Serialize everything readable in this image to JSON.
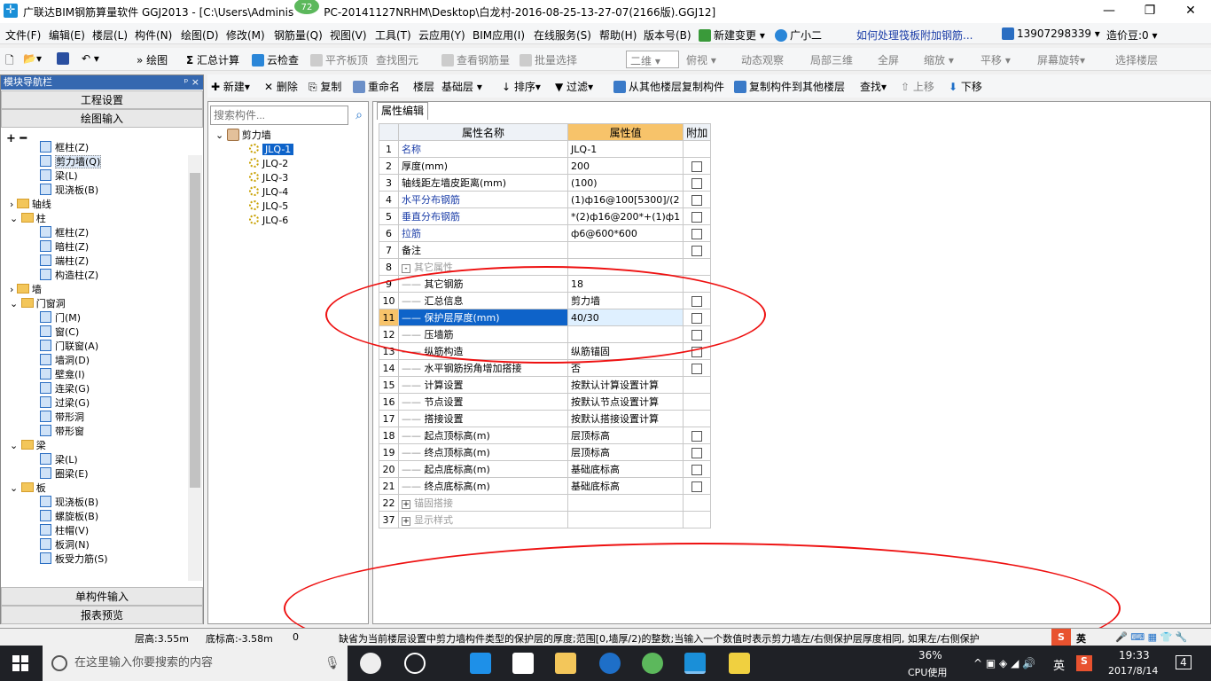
{
  "window": {
    "title": "广联达BIM钢筋算量软件 GGJ2013 - [C:\\Users\\Adminis",
    "title_rest": "PC-20141127NRHM\\Desktop\\白龙村-2016-08-25-13-27-07(2166版).GGJ12]",
    "badge": "72",
    "min": "—",
    "max": "❐",
    "close": "✕"
  },
  "menu": [
    "文件(F)",
    "编辑(E)",
    "楼层(L)",
    "构件(N)",
    "绘图(D)",
    "修改(M)",
    "钢筋量(Q)",
    "视图(V)",
    "工具(T)",
    "云应用(Y)",
    "BIM应用(I)",
    "在线服务(S)",
    "帮助(H)",
    "版本号(B)"
  ],
  "menu_extra": {
    "new_change": "新建变更",
    "assistant": "广小二",
    "question": "如何处理筏板附加钢筋...",
    "phone": "13907298339",
    "beans": "造价豆:0"
  },
  "toolbar1": {
    "draw": "绘图",
    "sum": "汇总计算",
    "cloud": "云检查",
    "flat": "平齐板顶",
    "find": "查找图元",
    "view_steel": "查看钢筋量",
    "batch": "批量选择",
    "mode": "二维",
    "top": "俯视",
    "dyn": "动态观察",
    "local3d": "局部三维",
    "full": "全屏",
    "zoom": "缩放",
    "pan": "平移",
    "rotate": "屏幕旋转",
    "floor": "选择楼层"
  },
  "nav": {
    "header": "模块导航栏",
    "pin": "ᵖ ×",
    "project": "工程设置",
    "drawing": "绘图输入",
    "single": "单构件输入",
    "report": "报表预览",
    "tree": [
      {
        "t": "框柱(Z)",
        "lv": 2,
        "i": "c"
      },
      {
        "t": "剪力墙(Q)",
        "lv": 2,
        "i": "c",
        "sel": true
      },
      {
        "t": "梁(L)",
        "lv": 2,
        "i": "c"
      },
      {
        "t": "现浇板(B)",
        "lv": 2,
        "i": "c"
      },
      {
        "t": "轴线",
        "lv": 1,
        "i": "f",
        "ex": "›"
      },
      {
        "t": "柱",
        "lv": 1,
        "i": "f",
        "ex": "⌄"
      },
      {
        "t": "框柱(Z)",
        "lv": 2,
        "i": "c"
      },
      {
        "t": "暗柱(Z)",
        "lv": 2,
        "i": "c"
      },
      {
        "t": "端柱(Z)",
        "lv": 2,
        "i": "c"
      },
      {
        "t": "构造柱(Z)",
        "lv": 2,
        "i": "c"
      },
      {
        "t": "墙",
        "lv": 1,
        "i": "f",
        "ex": "›"
      },
      {
        "t": "门窗洞",
        "lv": 1,
        "i": "f",
        "ex": "⌄"
      },
      {
        "t": "门(M)",
        "lv": 2,
        "i": "c"
      },
      {
        "t": "窗(C)",
        "lv": 2,
        "i": "c"
      },
      {
        "t": "门联窗(A)",
        "lv": 2,
        "i": "c"
      },
      {
        "t": "墙洞(D)",
        "lv": 2,
        "i": "c"
      },
      {
        "t": "壁龛(I)",
        "lv": 2,
        "i": "c"
      },
      {
        "t": "连梁(G)",
        "lv": 2,
        "i": "c"
      },
      {
        "t": "过梁(G)",
        "lv": 2,
        "i": "c"
      },
      {
        "t": "带形洞",
        "lv": 2,
        "i": "c"
      },
      {
        "t": "带形窗",
        "lv": 2,
        "i": "c"
      },
      {
        "t": "梁",
        "lv": 1,
        "i": "f",
        "ex": "⌄"
      },
      {
        "t": "梁(L)",
        "lv": 2,
        "i": "c"
      },
      {
        "t": "圈梁(E)",
        "lv": 2,
        "i": "c"
      },
      {
        "t": "板",
        "lv": 1,
        "i": "f",
        "ex": "⌄"
      },
      {
        "t": "现浇板(B)",
        "lv": 2,
        "i": "c"
      },
      {
        "t": "螺旋板(B)",
        "lv": 2,
        "i": "c"
      },
      {
        "t": "柱帽(V)",
        "lv": 2,
        "i": "c"
      },
      {
        "t": "板洞(N)",
        "lv": 2,
        "i": "c"
      },
      {
        "t": "板受力筋(S)",
        "lv": 2,
        "i": "c"
      }
    ]
  },
  "toolbar2": {
    "new": "新建",
    "delete": "删除",
    "copy": "复制",
    "rename": "重命名",
    "floor": "楼层",
    "base": "基础层",
    "sort": "排序",
    "filter": "过滤",
    "copy_from": "从其他楼层复制构件",
    "copy_to": "复制构件到其他楼层",
    "find": "查找",
    "up": "上移",
    "down": "下移"
  },
  "components": {
    "placeholder": "搜索构件...",
    "root": "剪力墙",
    "items": [
      "JLQ-1",
      "JLQ-2",
      "JLQ-3",
      "JLQ-4",
      "JLQ-5",
      "JLQ-6"
    ]
  },
  "props": {
    "tab": "属性编辑",
    "h_name": "属性名称",
    "h_val": "属性值",
    "h_att": "附加",
    "rows": [
      {
        "n": "1",
        "name": "名称",
        "val": "JLQ-1",
        "cb": false,
        "blue": true
      },
      {
        "n": "2",
        "name": "厚度(mm)",
        "val": "200",
        "cb": true
      },
      {
        "n": "3",
        "name": "轴线距左墙皮距离(mm)",
        "val": "(100)",
        "cb": true
      },
      {
        "n": "4",
        "name": "水平分布钢筋",
        "val": "(1)ф16@100[5300]/(2",
        "cb": true,
        "blue": true
      },
      {
        "n": "5",
        "name": "垂直分布钢筋",
        "val": "*(2)ф16@200*+(1)ф1",
        "cb": true,
        "blue": true
      },
      {
        "n": "6",
        "name": "拉筋",
        "val": "ф6@600*600",
        "cb": true,
        "blue": true
      },
      {
        "n": "7",
        "name": "备注",
        "val": "",
        "cb": true
      },
      {
        "n": "8",
        "name": "其它属性",
        "val": "",
        "cb": false,
        "group": "-"
      },
      {
        "n": "9",
        "name": "其它钢筋",
        "val": "18",
        "cb": false,
        "sub": true
      },
      {
        "n": "10",
        "name": "汇总信息",
        "val": "剪力墙",
        "cb": true,
        "sub": true
      },
      {
        "n": "11",
        "name": "保护层厚度(mm)",
        "val": "40/30",
        "cb": true,
        "sub": true,
        "sel": true
      },
      {
        "n": "12",
        "name": "压墙筋",
        "val": "",
        "cb": true,
        "sub": true
      },
      {
        "n": "13",
        "name": "纵筋构造",
        "val": "纵筋锚固",
        "cb": true,
        "sub": true
      },
      {
        "n": "14",
        "name": "水平钢筋拐角增加搭接",
        "val": "否",
        "cb": true,
        "sub": true
      },
      {
        "n": "15",
        "name": "计算设置",
        "val": "按默认计算设置计算",
        "cb": false,
        "sub": true
      },
      {
        "n": "16",
        "name": "节点设置",
        "val": "按默认节点设置计算",
        "cb": false,
        "sub": true
      },
      {
        "n": "17",
        "name": "搭接设置",
        "val": "按默认搭接设置计算",
        "cb": false,
        "sub": true
      },
      {
        "n": "18",
        "name": "起点顶标高(m)",
        "val": "层顶标高",
        "cb": true,
        "sub": true
      },
      {
        "n": "19",
        "name": "终点顶标高(m)",
        "val": "层顶标高",
        "cb": true,
        "sub": true
      },
      {
        "n": "20",
        "name": "起点底标高(m)",
        "val": "基础底标高",
        "cb": true,
        "sub": true
      },
      {
        "n": "21",
        "name": "终点底标高(m)",
        "val": "基础底标高",
        "cb": true,
        "sub": true
      },
      {
        "n": "22",
        "name": "锚固搭接",
        "val": "",
        "cb": false,
        "group": "+"
      },
      {
        "n": "37",
        "name": "显示样式",
        "val": "",
        "cb": false,
        "group": "+"
      }
    ]
  },
  "status": {
    "floor_h": "层高:3.55m",
    "base_h": "底标高:-3.58m",
    "zero": "0",
    "hint": "缺省为当前楼层设置中剪力墙构件类型的保护层的厚度;范围[0,墙厚/2)的整数;当输入一个数值时表示剪力墙左/右侧保护层厚度相同, 如果左/右侧保护",
    "ime": "英"
  },
  "taskbar": {
    "search": "在这里输入你要搜索的内容",
    "cpu": "36%",
    "cpu_label": "CPU使用",
    "ime": "英",
    "time": "19:33",
    "date": "2017/8/14",
    "notif": "4"
  },
  "colors": {
    "accent": "#0e63c9",
    "header_orange": "#f7c36a",
    "annot": "#e11111"
  }
}
